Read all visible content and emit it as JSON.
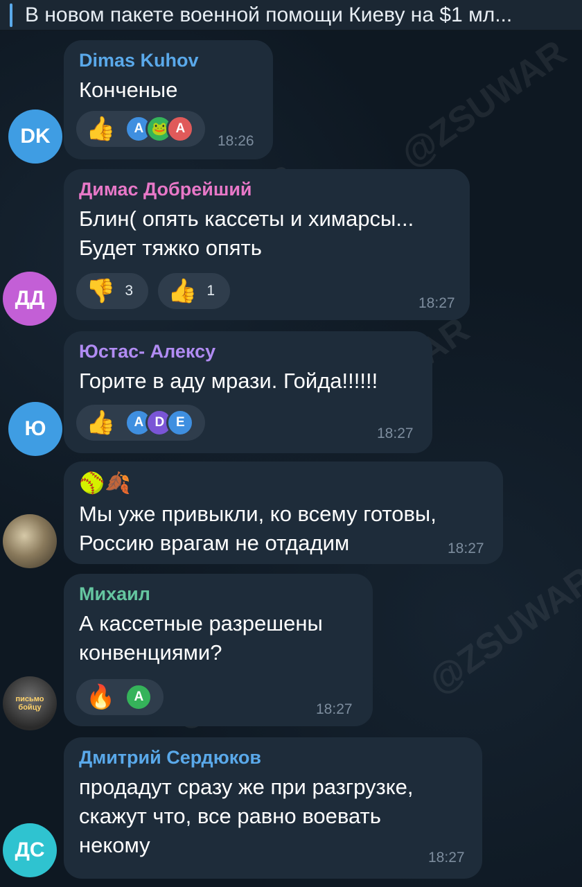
{
  "pinned": {
    "text": "В новом пакете военной помощи Киеву на $1 мл..."
  },
  "watermark": "@ZSUWAR",
  "colors": {
    "bubble": "#1e2c3a",
    "reaction_bg": "#2f3d4c",
    "time": "#7d8d9e"
  },
  "messages": [
    {
      "author": "Dimas Kuhov",
      "author_color": "#5aa9ea",
      "avatar_initials": "DK",
      "avatar_color": "#3f9de3",
      "lines": [
        "Конченые"
      ],
      "time": "18:26",
      "reactions": [
        {
          "emoji": "👍",
          "users": [
            "A",
            "🐸",
            "A"
          ]
        }
      ]
    },
    {
      "author": "Димас Добрейший",
      "author_color": "#e878c8",
      "avatar_initials": "ДД",
      "avatar_color": "#c35fd6",
      "lines": [
        "Блин( опять кассеты и химарсы...",
        "Будет тяжко опять"
      ],
      "time": "18:27",
      "reactions": [
        {
          "emoji": "👎",
          "count": "3"
        },
        {
          "emoji": "👍",
          "count": "1"
        }
      ]
    },
    {
      "author": "Юстас- Алексу",
      "author_color": "#b18cf3",
      "avatar_initials": "Ю",
      "avatar_color": "#3f9de3",
      "lines": [
        "Горите в аду мрази. Гойда!!!!!!"
      ],
      "time": "18:27",
      "reactions": [
        {
          "emoji": "👍",
          "users": [
            "A",
            "D",
            "E"
          ]
        }
      ]
    },
    {
      "author": "🥎🍂",
      "lines": [
        "Мы уже привыкли, ко всему готовы,",
        "Россию врагам не отдадим"
      ],
      "time": "18:27"
    },
    {
      "author": "Михаил",
      "author_color": "#65c6a0",
      "avatar_label": "письмо бойцу",
      "lines": [
        "А кассетные разрешены",
        "конвенциями?"
      ],
      "time": "18:27",
      "reactions": [
        {
          "emoji": "🔥",
          "users": [
            "A"
          ]
        }
      ]
    },
    {
      "author": "Дмитрий Сердюков",
      "author_color": "#5aa9ea",
      "avatar_initials": "ДС",
      "avatar_color": "#2fc3d0",
      "lines": [
        "продадут сразу же при разгрузке,",
        "скажут что, все равно воевать",
        "некому"
      ],
      "time": "18:27"
    }
  ]
}
